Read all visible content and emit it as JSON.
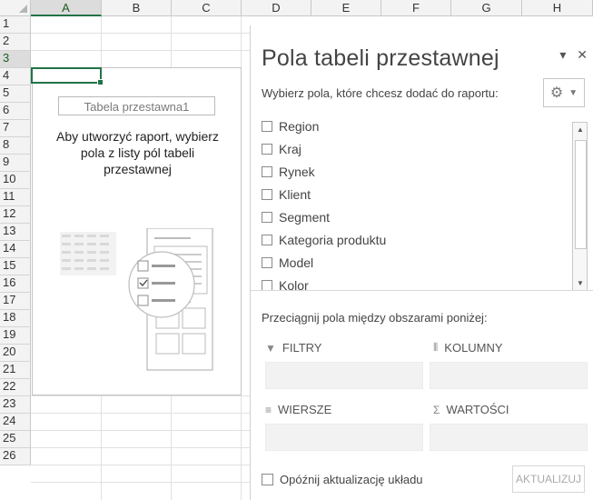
{
  "columns": [
    "A",
    "B",
    "C",
    "D",
    "E",
    "F",
    "G",
    "H"
  ],
  "rows": [
    "1",
    "2",
    "3",
    "4",
    "5",
    "6",
    "7",
    "8",
    "9",
    "10",
    "11",
    "12",
    "13",
    "14",
    "15",
    "16",
    "17",
    "18",
    "19",
    "20",
    "21",
    "22",
    "23",
    "24",
    "25",
    "26"
  ],
  "placeholder": {
    "name": "Tabela przestawna1",
    "line1": "Aby utworzyć raport, wybierz",
    "line2": "pola z listy pól tabeli",
    "line3": "przestawnej"
  },
  "pane": {
    "title": "Pola tabeli przestawnej",
    "subtitle": "Wybierz pola, które chcesz dodać do raportu:",
    "fields": [
      "Region",
      "Kraj",
      "Rynek",
      "Klient",
      "Segment",
      "Kategoria produktu",
      "Model",
      "Kolor"
    ],
    "drag_hint": "Przeciągnij pola między obszarami poniżej:",
    "areas": {
      "filters": "FILTRY",
      "columns": "KOLUMNY",
      "rows": "WIERSZE",
      "values": "WARTOŚCI"
    },
    "defer_label": "Opóźnij aktualizację układu",
    "update_label": "AKTUALIZUJ"
  },
  "icons": {
    "pane_menu": "chevron-down-icon",
    "pane_close": "close-icon",
    "settings": "gear-icon",
    "filter": "funnel-icon",
    "columns": "columns-icon",
    "rows": "rows-icon",
    "values": "sigma-icon"
  },
  "colors": {
    "accent": "#217346"
  }
}
